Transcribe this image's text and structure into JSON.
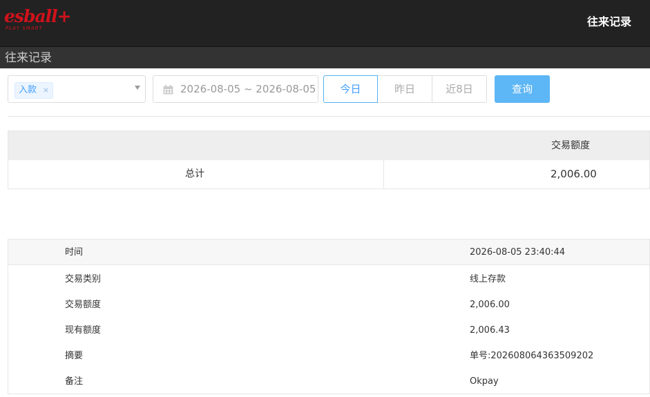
{
  "header": {
    "logo_text": "esball+",
    "logo_tagline": "PLAY SMART",
    "title": "往来记录"
  },
  "subheader": {
    "title": "往来记录"
  },
  "filters": {
    "type_tag": "入款",
    "tag_close": "×",
    "date_range": "2026-08-05 ~ 2026-08-05",
    "buttons": {
      "today": "今日",
      "yesterday": "昨日",
      "last8": "近8日"
    },
    "query": "查询"
  },
  "summary": {
    "column_header": "交易额度",
    "row_label": "总计",
    "row_value": "2,006.00"
  },
  "detail": {
    "rows": [
      {
        "label": "时间",
        "value": "2026-08-05 23:40:44"
      },
      {
        "label": "交易类别",
        "value": "线上存款"
      },
      {
        "label": "交易额度",
        "value": "2,006.00"
      },
      {
        "label": "现有额度",
        "value": "2,006.43"
      },
      {
        "label": "摘要",
        "value": "单号:202608064363509202"
      },
      {
        "label": "备注",
        "value": "Okpay"
      }
    ]
  },
  "colors": {
    "topbar": "#222222",
    "brand_red": "#d0121b",
    "accent_blue": "#409eff",
    "query_button": "#5db6f5"
  }
}
